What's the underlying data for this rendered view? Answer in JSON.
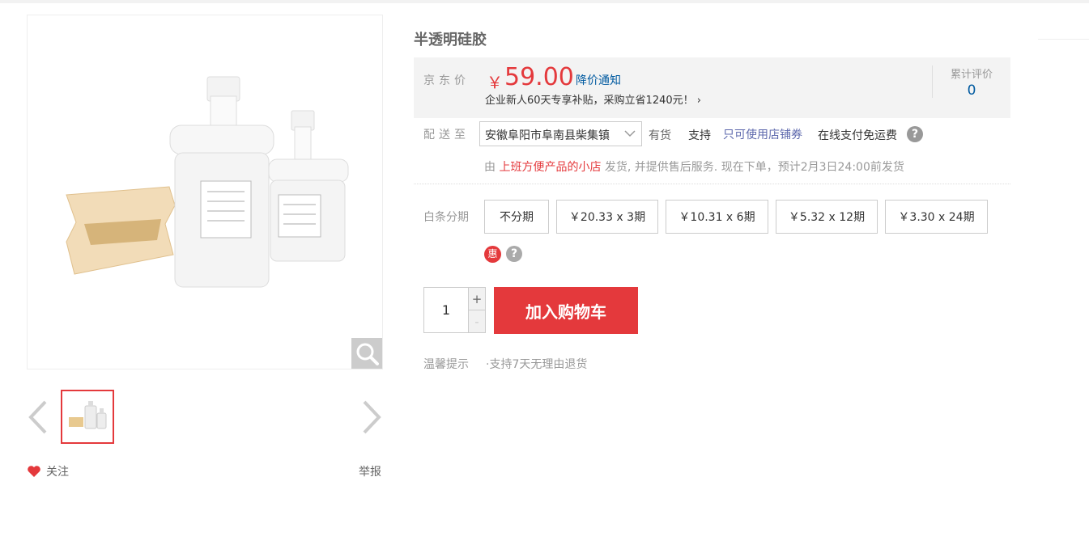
{
  "product": {
    "title": "半透明硅胶",
    "thumb_count": 1
  },
  "gallery": {
    "follow_label": "关注",
    "report_label": "举报"
  },
  "price": {
    "label": "京东价",
    "currency": "￥",
    "value": "59.00",
    "notice": "降价通知",
    "promo": "企业新人60天专享补贴，采购立省1240元！ ›",
    "review_title": "累计评价",
    "review_count": "0"
  },
  "shipping": {
    "label": "配送至",
    "address": "安徽阜阳市阜南县柴集镇",
    "stock": "有货",
    "support": "支持",
    "coupon": "只可使用店铺券",
    "online": "在线支付免运费",
    "by_prefix": "由",
    "shop": "上班方便产品的小店",
    "by_suffix": "发货, 并提供售后服务. 现在下单，预计2月3日24:00前发货"
  },
  "baitiao": {
    "label": "白条分期",
    "options": [
      "不分期",
      "￥20.33 x 3期",
      "￥10.31 x 6期",
      "￥5.32 x 12期",
      "￥3.30 x 24期"
    ],
    "hui": "惠"
  },
  "purchase": {
    "quantity": "1",
    "plus": "+",
    "minus": "-",
    "cart_label": "加入购物车"
  },
  "tips": {
    "label": "温馨提示",
    "text": "·支持7天无理由退货"
  },
  "colors": {
    "accent": "#e4393c",
    "link": "#005aa0"
  }
}
